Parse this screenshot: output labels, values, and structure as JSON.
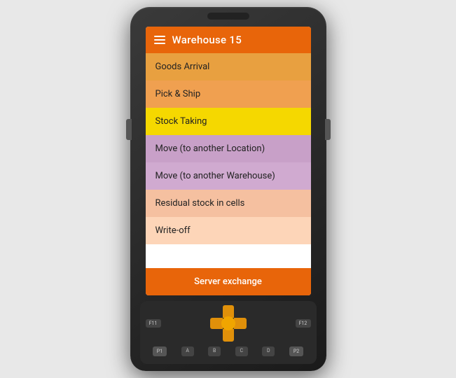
{
  "header": {
    "title": "Warehouse 15",
    "menu_icon": "hamburger"
  },
  "menu_items": [
    {
      "id": "goods-arrival",
      "label": "Goods Arrival",
      "bg": "#e8a040",
      "color": "#222"
    },
    {
      "id": "pick-ship",
      "label": "Pick & Ship",
      "bg": "#f0a050",
      "color": "#222"
    },
    {
      "id": "stock-taking",
      "label": "Stock Taking",
      "bg": "#f5d800",
      "color": "#222"
    },
    {
      "id": "move-location",
      "label": "Move (to another Location)",
      "bg": "#c8a0c8",
      "color": "#222"
    },
    {
      "id": "move-warehouse",
      "label": "Move (to another Warehouse)",
      "bg": "#d0aad0",
      "color": "#222"
    },
    {
      "id": "residual-stock",
      "label": "Residual stock in cells",
      "bg": "#f5c0a0",
      "color": "#222"
    },
    {
      "id": "write-off",
      "label": "Write-off",
      "bg": "#fdd5b8",
      "color": "#222"
    }
  ],
  "server_exchange": {
    "label": "Server exchange",
    "bg": "#e8650a",
    "color": "#ffffff"
  },
  "keypad": {
    "fn11": "F11",
    "fn12": "F12",
    "p1": "P1",
    "p2": "P2",
    "keys": [
      "A",
      "B",
      "C",
      "D"
    ]
  }
}
